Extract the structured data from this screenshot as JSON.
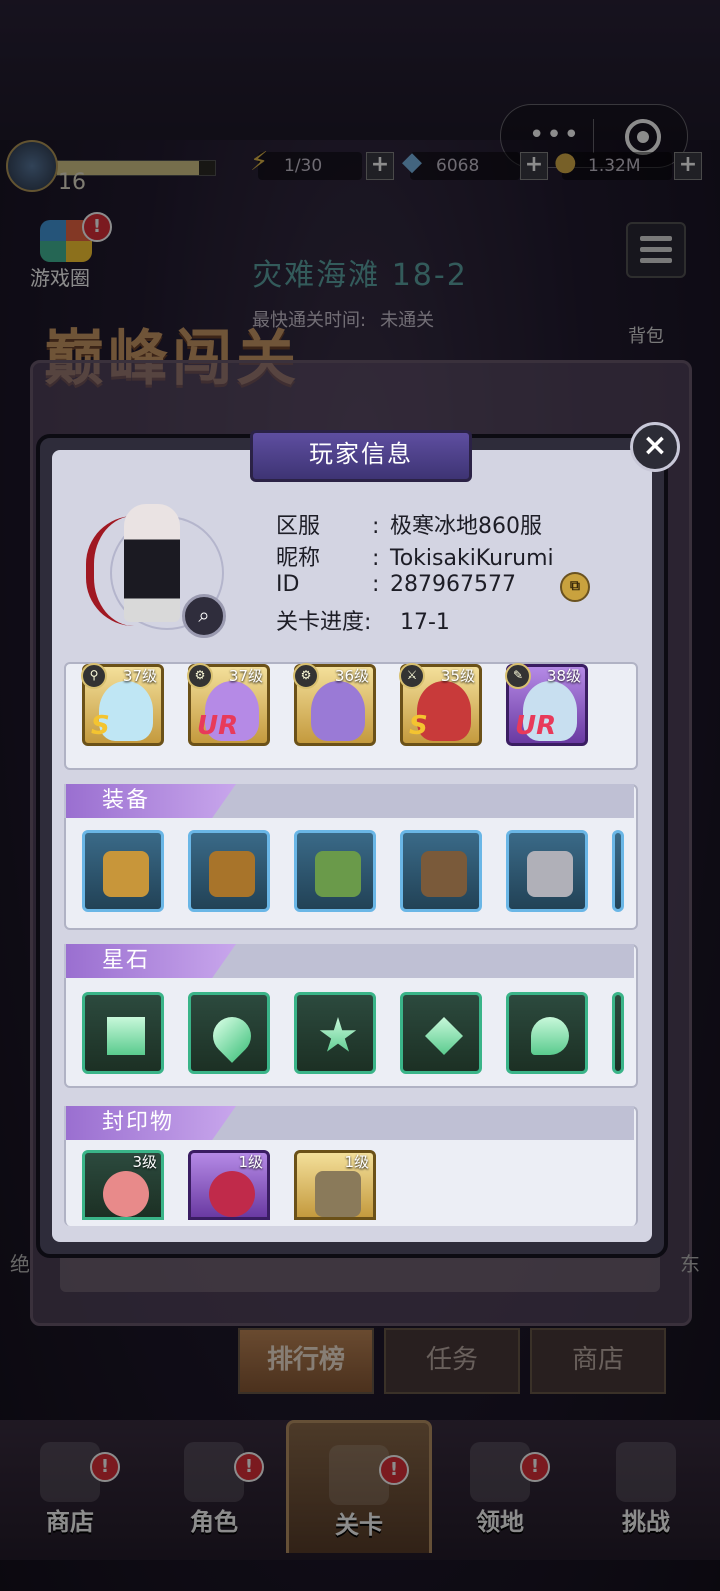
{
  "topbar": {
    "level": "16",
    "xp_fraction": 0.9,
    "energy": "1/30",
    "diamonds": "6068",
    "gold": "1.32M",
    "plus": "+"
  },
  "capsule": {
    "dots": "•••"
  },
  "stage": {
    "title": "灾难海滩 18-2",
    "best_label": "最快通关时间:",
    "best_value": "未通关",
    "peak_title": "巅峰闯关"
  },
  "game_circle": {
    "label": "游戏圈",
    "badge": "!"
  },
  "bag": {
    "label": "背包"
  },
  "ghost": {
    "left": "绝",
    "right": "东"
  },
  "tabs": [
    {
      "label": "排行榜",
      "active": true
    },
    {
      "label": "任务",
      "active": false
    },
    {
      "label": "商店",
      "active": false
    }
  ],
  "nav": [
    {
      "label": "商店",
      "badge": "!"
    },
    {
      "label": "角色",
      "badge": "!"
    },
    {
      "label": "关卡",
      "badge": "!"
    },
    {
      "label": "领地",
      "badge": "!"
    },
    {
      "label": "挑战",
      "badge": "!"
    }
  ],
  "modal": {
    "title": "玩家信息",
    "close": "×",
    "info": {
      "server_label": "区服",
      "server_value": "极寒冰地860服",
      "nick_label": "昵称",
      "nick_value": "TokisakiKurumi",
      "id_label": "ID",
      "id_value": "287967577",
      "progress_label": "关卡进度:",
      "progress_value": "17-1",
      "colon": ":"
    },
    "heroes": [
      {
        "level": "37级",
        "rank": "S",
        "frame": "gold"
      },
      {
        "level": "37级",
        "rank": "UR",
        "frame": "gold"
      },
      {
        "level": "36级",
        "rank": "",
        "frame": "gold"
      },
      {
        "level": "35级",
        "rank": "S",
        "frame": "gold"
      },
      {
        "level": "38级",
        "rank": "UR",
        "frame": "purple"
      }
    ],
    "equip_title": "装备",
    "gem_title": "星石",
    "seal_title": "封印物",
    "seals": [
      {
        "level": "3级",
        "frame": "green"
      },
      {
        "level": "1级",
        "frame": "purple"
      },
      {
        "level": "1级",
        "frame": "gold"
      }
    ]
  },
  "colors": {
    "accent": "#9a6fd0",
    "badge": "#e0303a",
    "panel": "#d3d4e2"
  }
}
